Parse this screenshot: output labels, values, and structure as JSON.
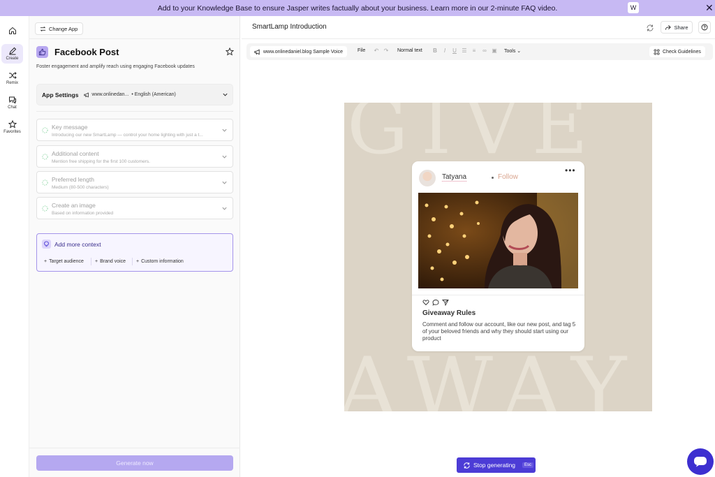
{
  "banner": {
    "text": "Add to your Knowledge Base to ensure Jasper writes factually about your business. Learn more in our 2-minute FAQ video.",
    "button": "W"
  },
  "rail": {
    "items": [
      {
        "label": "",
        "icon": "home-icon"
      },
      {
        "label": "Create",
        "icon": "pen-icon"
      },
      {
        "label": "Remix",
        "icon": "shuffle-icon"
      },
      {
        "label": "Chat",
        "icon": "chat-icon"
      },
      {
        "label": "Favorites",
        "icon": "star-icon"
      }
    ]
  },
  "panel": {
    "change_app": "Change App",
    "title": "Facebook Post",
    "description": "Foster engagement and amplify reach using engaging Facebook updates",
    "settings": {
      "title": "App Settings",
      "voice": "www.onlinedan...",
      "language": "• English (American)"
    },
    "fields": [
      {
        "label": "Key message",
        "sub": "Introducing our new SmartLamp — control your home lighting with just a t..."
      },
      {
        "label": "Additional content",
        "sub": "Mention free shipping for the first 100 customers."
      },
      {
        "label": "Preferred length",
        "sub": "Medium (80-500 characters)"
      },
      {
        "label": "Create an image",
        "sub": "Based on information provided"
      }
    ],
    "context": {
      "title": "Add more context",
      "chips": [
        "Target audience",
        "Brand voice",
        "Custom information"
      ]
    },
    "generate": "Generate now"
  },
  "doc": {
    "title": "SmartLamp Introduction",
    "share": "Share",
    "toolbar": {
      "voice": "www.onlinedaniel.blog Sample Voice",
      "file": "File",
      "style": "Normal text",
      "tools": "Tools",
      "check": "Check Guidelines"
    }
  },
  "post": {
    "bg_top": "GIVE",
    "bg_bottom": "AWAY",
    "name": "Tatyana",
    "follow": "Follow",
    "heading": "Giveaway Rules",
    "body": "Comment and follow our account, like our new post, and tag 5 of your beloved friends and why they should start using our product"
  },
  "bottom": {
    "stop": "Stop generating",
    "esc": "Esc"
  },
  "colors": {
    "accent": "#4c3cd6",
    "banner": "#c7b9f3",
    "generate_disabled": "#b5a8f0"
  }
}
